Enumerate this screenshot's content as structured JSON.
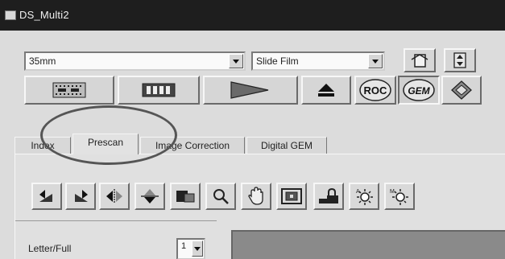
{
  "window": {
    "title": "DS_Multi2"
  },
  "film_format": {
    "selected": "35mm"
  },
  "film_type": {
    "selected": "Slide Film"
  },
  "toolbar": {
    "buttons": [
      {
        "name": "strip-scan-button",
        "icon": "film-strip-dotted-icon"
      },
      {
        "name": "filmstrip-button",
        "icon": "filmstrip-icon"
      },
      {
        "name": "play-button",
        "icon": "play-triangle-icon"
      },
      {
        "name": "eject-button",
        "icon": "eject-icon"
      },
      {
        "name": "roc-button",
        "icon": "roc-icon",
        "label": "ROC"
      },
      {
        "name": "gem-button",
        "icon": "gem-icon",
        "label": "GEM"
      },
      {
        "name": "slide-holder-button",
        "icon": "diamond-slide-icon"
      }
    ],
    "top_right": [
      {
        "name": "document-button",
        "icon": "document-icon"
      },
      {
        "name": "scale-button",
        "icon": "arrows-vertical-icon"
      }
    ]
  },
  "tabs": [
    {
      "label": "Index",
      "active": false
    },
    {
      "label": "Prescan",
      "active": true
    },
    {
      "label": "Image Correction",
      "active": false
    },
    {
      "label": "Digital GEM",
      "active": false
    }
  ],
  "tools": [
    "rotate-left-icon",
    "rotate-right-icon",
    "flip-horizontal-icon",
    "flip-vertical-icon",
    "crop-icon",
    "zoom-icon",
    "hand-icon",
    "frame-icon",
    "lock-icon",
    "brightness-icon",
    "contrast-icon"
  ],
  "bottom": {
    "layout_label": "Letter/Full",
    "small_field_text": "1"
  },
  "colors": {
    "titlebar": "#1e1e1e",
    "annotation": "#555555"
  }
}
